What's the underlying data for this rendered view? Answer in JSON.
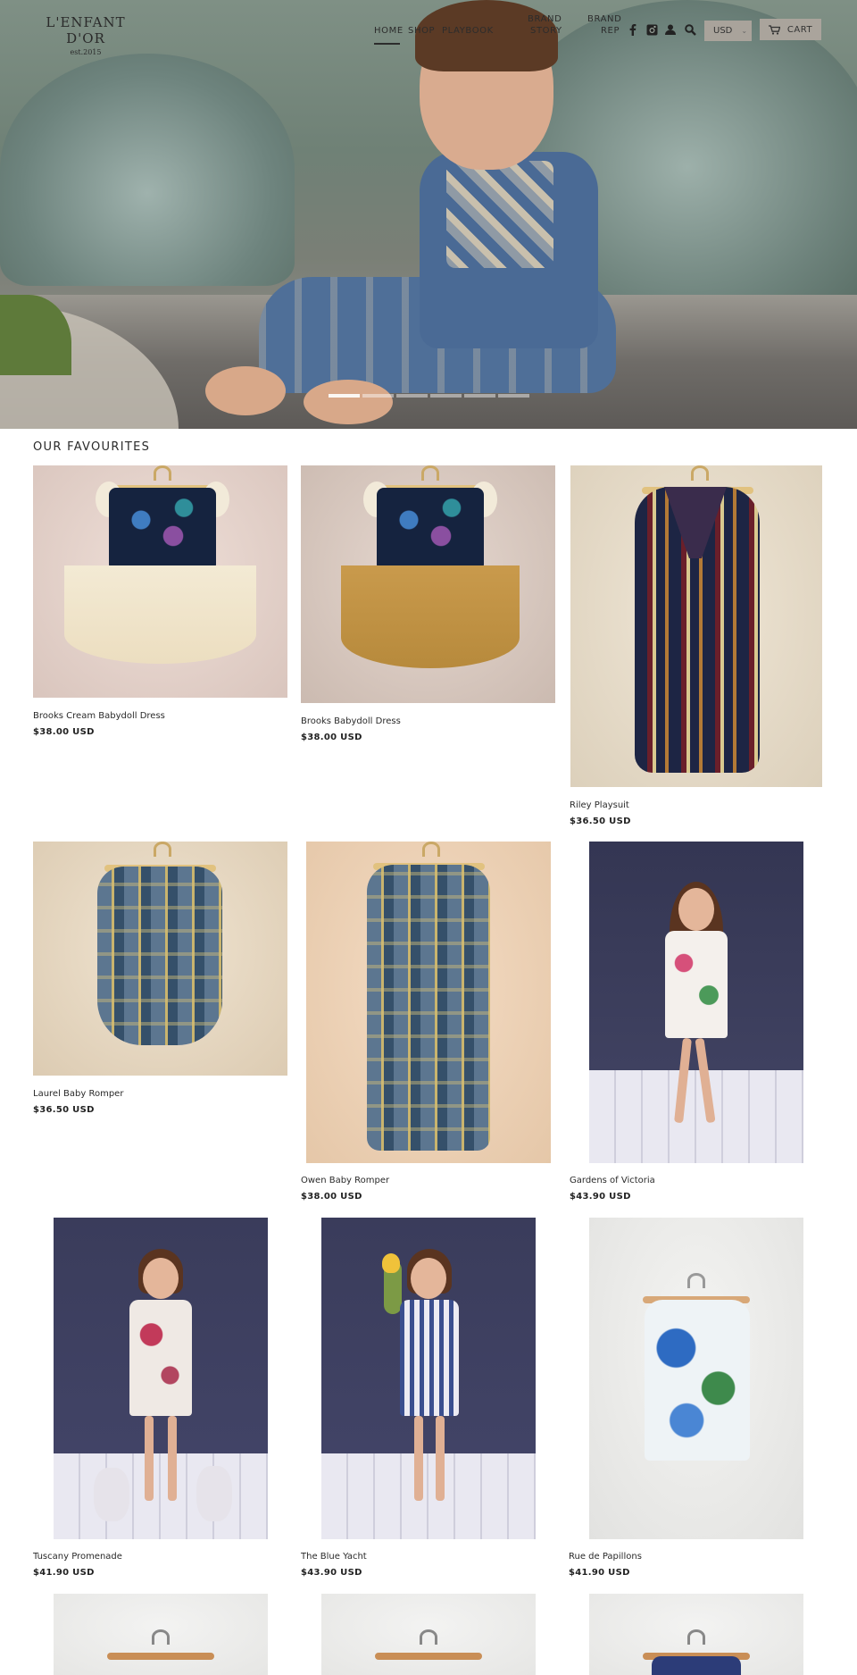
{
  "brand": {
    "name": "L'ENFANT D'OR",
    "tagline": "est.2015"
  },
  "nav": {
    "home": "HOME",
    "shop": "SHOP",
    "playbook": "PLAYBOOK",
    "brand_story_1": "BRAND",
    "brand_story_2": "STORY",
    "brand_rep_1": "BRAND",
    "brand_rep_2": "REP"
  },
  "header_icons": [
    "facebook-icon",
    "instagram-icon",
    "account-icon",
    "search-icon"
  ],
  "currency": {
    "selected": "USD"
  },
  "cart": {
    "label": "CART"
  },
  "hero": {
    "slides_total": 6,
    "active_slide": 1
  },
  "section": {
    "title": "OUR FAVOURITES"
  },
  "products": [
    {
      "name": "Brooks Cream Babydoll Dress",
      "price": "$38.00 USD"
    },
    {
      "name": "Brooks Babydoll Dress",
      "price": "$38.00 USD"
    },
    {
      "name": "Riley Playsuit",
      "price": "$36.50 USD"
    },
    {
      "name": "Laurel Baby Romper",
      "price": "$36.50 USD"
    },
    {
      "name": "Owen Baby Romper",
      "price": "$38.00 USD"
    },
    {
      "name": "Gardens of Victoria",
      "price": "$43.90 USD"
    },
    {
      "name": "Tuscany Promenade",
      "price": "$41.90 USD"
    },
    {
      "name": "The Blue Yacht",
      "price": "$43.90 USD"
    },
    {
      "name": "Rue de Papillons",
      "price": "$41.90 USD"
    }
  ],
  "colors": {
    "header_buttons": "#aaa49c",
    "text": "#2a2a2a",
    "studio_backdrop": "#3f4160"
  }
}
